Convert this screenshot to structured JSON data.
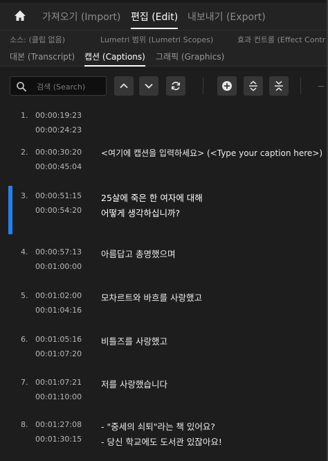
{
  "workspaces": {
    "import_label": "가져오기 (Import)",
    "edit_label": "편집 (Edit)",
    "export_label": "내보내기 (Export)"
  },
  "panel_tabs": {
    "source_label": "소스: (클립 없음)",
    "lumetri_label": "Lumetri 범위 (Lumetri Scopes)",
    "effect_label": "효과 컨트롤 (Effect Contr",
    "transcript_label": "대본 (Transcript)",
    "captions_label": "캡션 (Captions)",
    "graphics_label": "그래픽 (Graphics)"
  },
  "toolbar": {
    "search_placeholder": "검색 (Search)"
  },
  "captions": [
    {
      "num": "1.",
      "in": "00:00:19:23",
      "out": "00:00:24:23",
      "line1": "",
      "line2": ""
    },
    {
      "num": "2.",
      "in": "00:00:30:20",
      "out": "00:00:45:04",
      "line1": "<여기에 캡션을 입력하세요> (<Type your caption here>)",
      "line2": ""
    },
    {
      "num": "3.",
      "in": "00:00:51:15",
      "out": "00:00:54:20",
      "line1": "25살에 죽은 한 여자에 대해",
      "line2": "어떻게 생각하십니까?"
    },
    {
      "num": "4.",
      "in": "00:00:57:13",
      "out": "00:01:00:00",
      "line1": "아름답고 총명했으며",
      "line2": ""
    },
    {
      "num": "5.",
      "in": "00:01:02:00",
      "out": "00:01:04:16",
      "line1": "모차르트와 바흐를 사랑했고",
      "line2": ""
    },
    {
      "num": "6.",
      "in": "00:01:05:16",
      "out": "00:01:07:20",
      "line1": "비틀즈를 사랑했고",
      "line2": ""
    },
    {
      "num": "7.",
      "in": "00:01:07:21",
      "out": "00:01:10:00",
      "line1": "저를 사랑했습니다",
      "line2": ""
    },
    {
      "num": "8.",
      "in": "00:01:27:08",
      "out": "00:01:30:15",
      "line1": "- \"중세의 쇠퇴\"라는 책 있어요?",
      "line2": "- 당신 학교에도 도서관 있잖아요!"
    }
  ],
  "colors": {
    "selection_accent": "#2680eb",
    "background": "#1d1d1d"
  },
  "icons": [
    "home-icon",
    "search-icon",
    "arrow-up-icon",
    "arrow-down-icon",
    "refresh-icon",
    "add-icon",
    "expand-icon",
    "collapse-icon"
  ]
}
